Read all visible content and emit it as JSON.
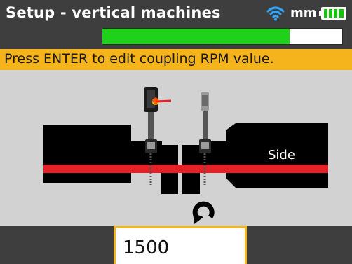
{
  "header": {
    "title": "Setup - vertical machines",
    "unit": "mm",
    "wifi_icon": "wifi-icon",
    "battery_icon": "battery-icon",
    "progress_fraction": 0.78,
    "progress_color": "#1fd11a"
  },
  "instruction": "Press ENTER to edit coupling RPM value.",
  "diagram": {
    "machine_label": "Side",
    "rotation_icon": "rotation-arrow-icon",
    "shaft_color": "#e52127",
    "laser_color": "#e52127"
  },
  "rpm_field": {
    "value": "1500"
  },
  "colors": {
    "accent": "#f6b41c",
    "titlebar": "#3e3e3e",
    "background": "#d2d2d2"
  }
}
